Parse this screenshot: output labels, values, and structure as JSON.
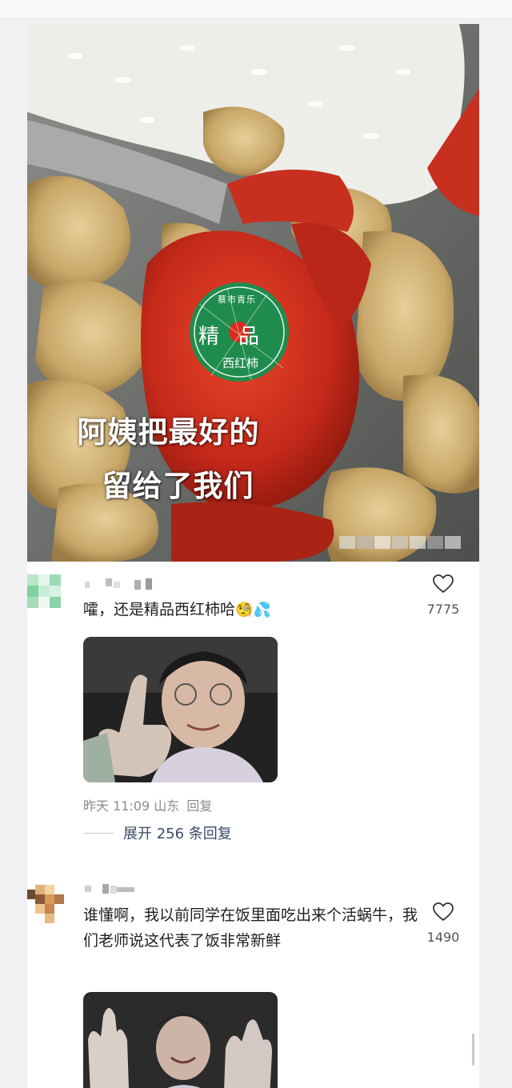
{
  "hero": {
    "caption_line1": "阿姨把最好的",
    "caption_line2": "留给了我们",
    "sticker": {
      "arc_text": "蔡市青乐",
      "center_text": "精品",
      "bottom_text": "西红柿",
      "color": "#1f8c4e"
    }
  },
  "comments": [
    {
      "text": "嚯，还是精品西红柿哈",
      "emoji": [
        "🧐",
        "💦"
      ],
      "likes": "7775",
      "meta_time": "昨天 11:09",
      "meta_location": "山东",
      "reply_label": "回复",
      "expand_label": "展开 256 条回复",
      "image_icon": "thumbs-up-photo"
    },
    {
      "text": "谁懂啊，我以前同学在饭里面吃出来个活蜗牛，我们老师说这代表了饭非常新鲜",
      "likes": "1490",
      "image_icon": "waving-hands-photo"
    }
  ],
  "colors": {
    "like_count": "#555555",
    "meta": "#8a8a8a",
    "expand": "#3a4a6a"
  }
}
